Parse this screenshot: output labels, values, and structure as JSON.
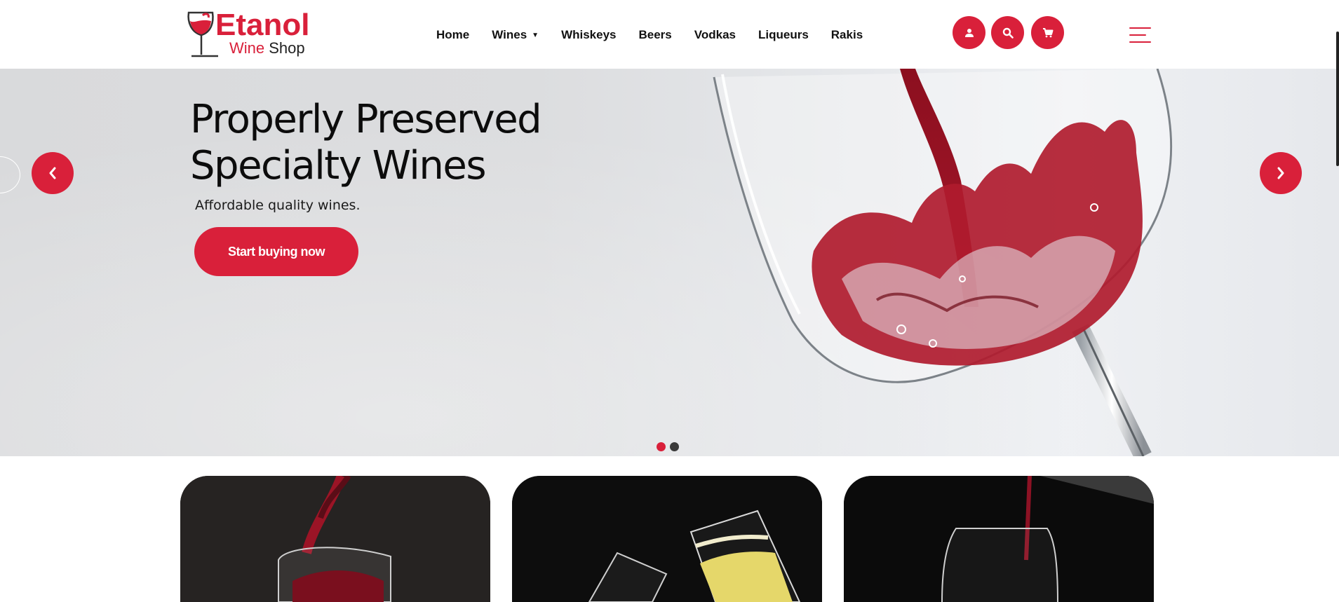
{
  "brand": {
    "name": "Etanol",
    "sub_wine": "Wine",
    "sub_shop": "Shop"
  },
  "nav": {
    "items": [
      {
        "label": "Home"
      },
      {
        "label": "Wines",
        "has_dropdown": true,
        "caret": "▼"
      },
      {
        "label": "Whiskeys"
      },
      {
        "label": "Beers"
      },
      {
        "label": "Vodkas"
      },
      {
        "label": "Liqueurs"
      },
      {
        "label": "Rakis"
      }
    ]
  },
  "header_icons": [
    "user-icon",
    "search-icon",
    "cart-icon",
    "menu-icon"
  ],
  "hero": {
    "title_line1": "Properly Preserved",
    "title_line2": "Specialty Wines",
    "subtitle": "Affordable quality wines.",
    "cta_label": "Start buying now",
    "prev_symbol": "‹",
    "next_symbol": "›",
    "slides_total": 2,
    "active_slide": 1
  },
  "cards": [
    {
      "name": "red-wine-pour-card"
    },
    {
      "name": "sparkling-toast-card"
    },
    {
      "name": "white-wine-pour-card"
    }
  ],
  "colors": {
    "accent": "#d9203a",
    "text": "#111111",
    "hero_bg": "#dcdddf",
    "dot_inactive": "#3a3a3a"
  }
}
